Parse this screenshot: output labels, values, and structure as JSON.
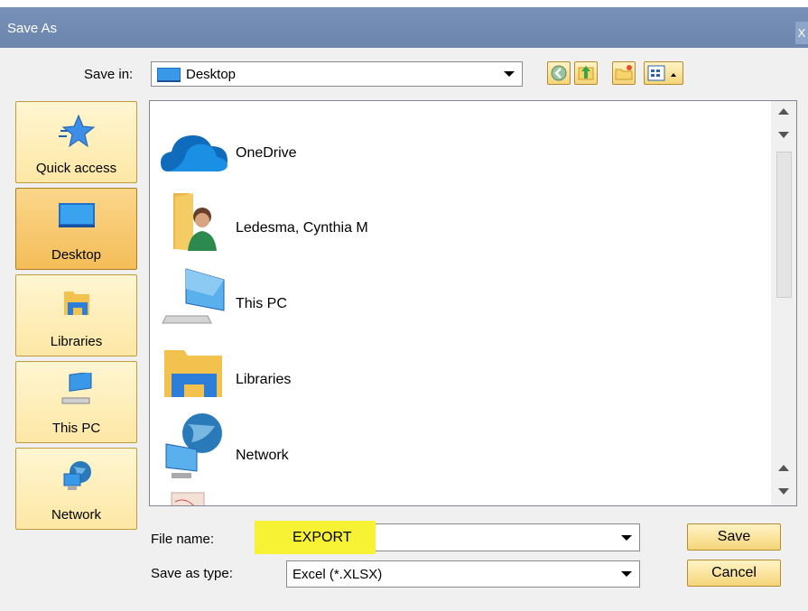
{
  "window": {
    "title": "Save As",
    "close_glyph": "X"
  },
  "save_in": {
    "label": "Save in:",
    "value": "Desktop"
  },
  "toolbar": {
    "buttons": [
      {
        "name": "back-icon"
      },
      {
        "name": "up-one-level-icon"
      },
      {
        "name": "new-folder-icon"
      },
      {
        "name": "view-menu-icon"
      }
    ]
  },
  "places": [
    {
      "label": "Quick access",
      "icon": "star-icon",
      "selected": false
    },
    {
      "label": "Desktop",
      "icon": "desktop-icon",
      "selected": true
    },
    {
      "label": "Libraries",
      "icon": "libraries-icon",
      "selected": false
    },
    {
      "label": "This PC",
      "icon": "computer-icon",
      "selected": false
    },
    {
      "label": "Network",
      "icon": "network-icon",
      "selected": false
    }
  ],
  "files": [
    {
      "name": "OneDrive",
      "icon": "onedrive-icon"
    },
    {
      "name": "Ledesma, Cynthia M",
      "icon": "user-folder-icon"
    },
    {
      "name": "This PC",
      "icon": "computer-icon"
    },
    {
      "name": "Libraries",
      "icon": "libraries-icon"
    },
    {
      "name": "Network",
      "icon": "network-icon"
    }
  ],
  "file_name": {
    "label": "File name:",
    "value": "EXPORT"
  },
  "save_as_type": {
    "label": "Save as type:",
    "value": "Excel (*.XLSX)"
  },
  "buttons": {
    "save": "Save",
    "cancel": "Cancel"
  },
  "colors": {
    "titlebar": "#6f89b1",
    "highlight": "#f7f233",
    "selected_place": "#f4bd59"
  }
}
